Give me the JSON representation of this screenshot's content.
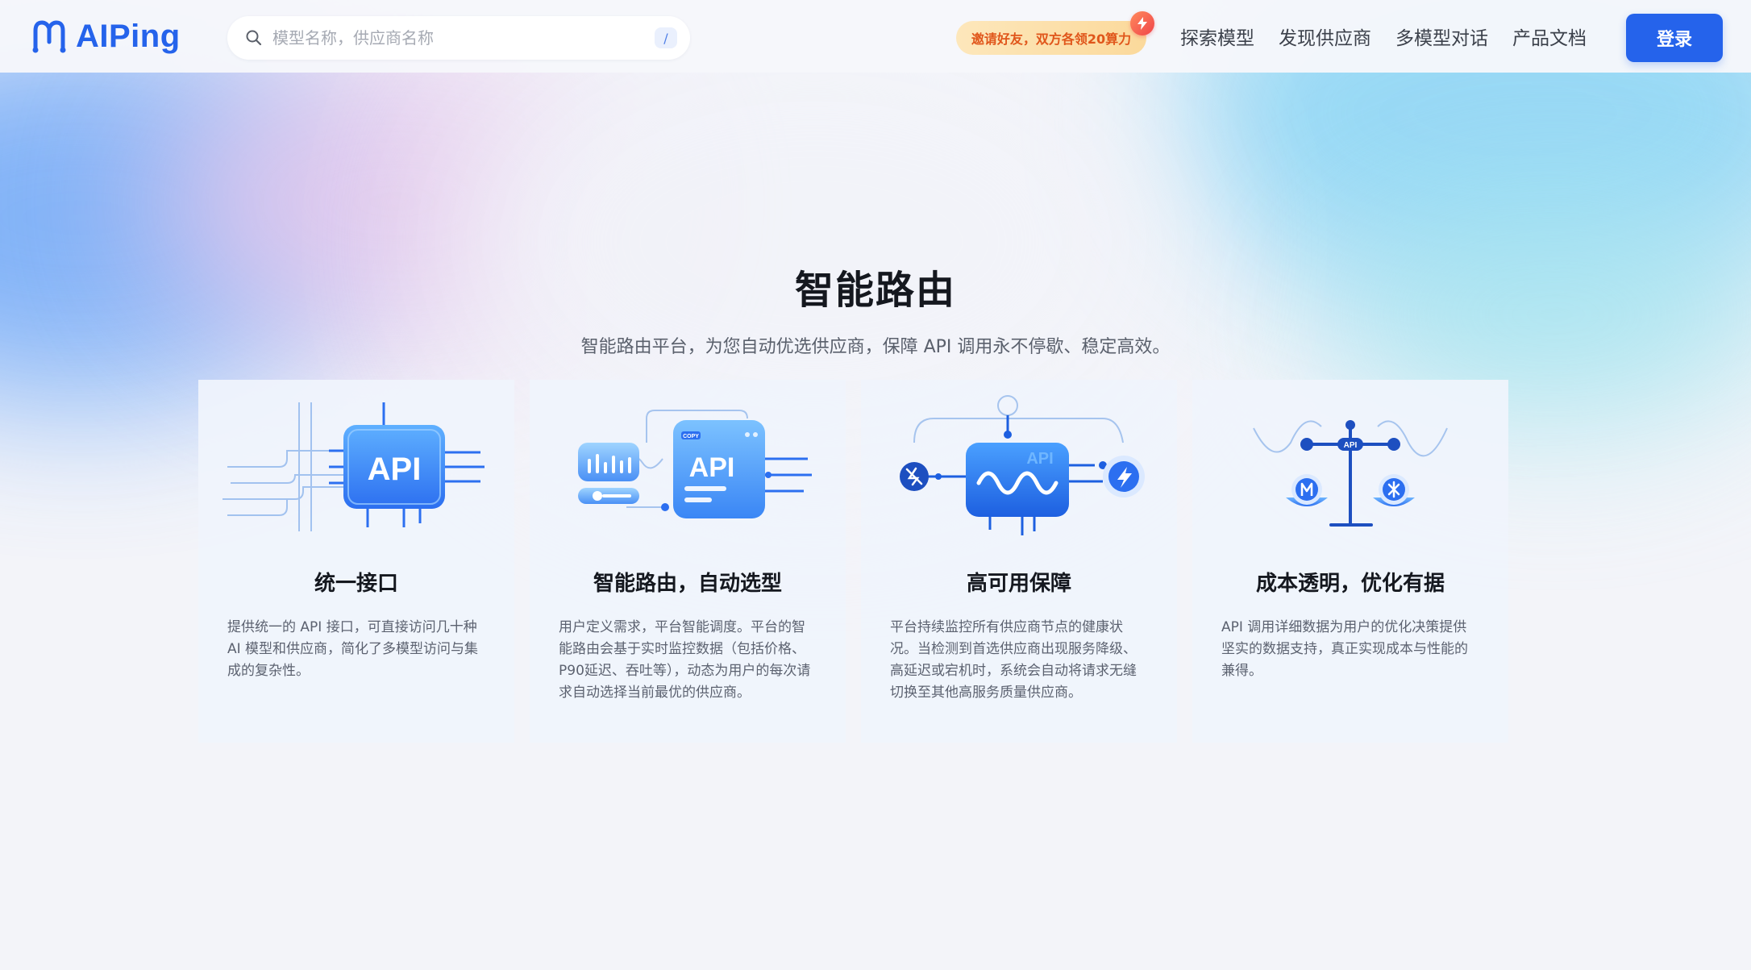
{
  "app": {
    "logo_text": "AIPing"
  },
  "search": {
    "placeholder": "模型名称，供应商名称",
    "shortcut": "/"
  },
  "promo": {
    "text": "邀请好友，双方各领20算力"
  },
  "nav": {
    "links": [
      "探索模型",
      "发现供应商",
      "多模型对话",
      "产品文档"
    ],
    "login_label": "登录"
  },
  "hero": {
    "title": "智能路由",
    "subtitle": "智能路由平台，为您自动优选供应商，保障 API 调用永不停歇、稳定高效。"
  },
  "cards": [
    {
      "title": "统一接口",
      "desc": "提供统一的 API 接口，可直接访问几十种 AI 模型和供应商，简化了多模型访问与集成的复杂性。",
      "icon": "api-chip-icon",
      "illus_text": "API"
    },
    {
      "title": "智能路由，自动选型",
      "desc": "用户定义需求，平台智能调度。平台的智能路由会基于实时监控数据（包括价格、P90延迟、吞吐等），动态为用户的每次请求自动选择当前最优的供应商。",
      "icon": "api-routing-icon",
      "illus_text": "API",
      "tag_text": "COPY"
    },
    {
      "title": "高可用保障",
      "desc": "平台持续监控所有供应商节点的健康状况。当检测到首选供应商出现服务降级、高延迟或宕机时，系统会自动将请求无缝切换至其他高服务质量供应商。",
      "icon": "api-failover-icon",
      "illus_text": "API"
    },
    {
      "title": "成本透明，优化有据",
      "desc": "API 调用详细数据为用户的优化决策提供坚实的数据支持，真正实现成本与性能的兼得。",
      "icon": "api-balance-icon",
      "illus_text": "API"
    }
  ],
  "colors": {
    "brand": "#2563eb",
    "promo_text": "#e0561b",
    "title": "#15181f",
    "subtitle": "#5a606c"
  }
}
